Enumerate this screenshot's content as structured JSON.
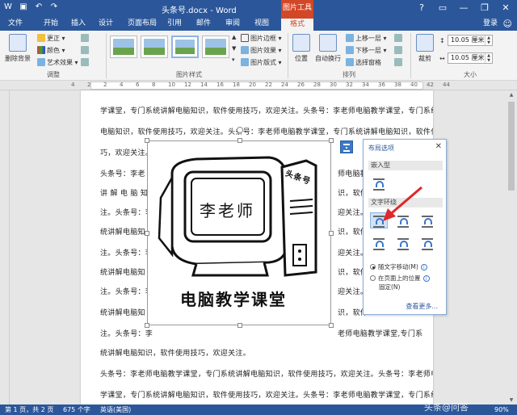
{
  "window": {
    "title": "头条号.docx - Word",
    "context_tool": "图片工具",
    "buttons": [
      "?",
      "▭",
      "—",
      "❐",
      "✕"
    ]
  },
  "quick_access": [
    "word-icon",
    "save-icon",
    "undo-icon",
    "redo-icon"
  ],
  "tabs": {
    "file": "文件",
    "items": [
      "开始",
      "插入",
      "设计",
      "页面布局",
      "引用",
      "邮件",
      "审阅",
      "视图",
      "格式"
    ],
    "active": "格式",
    "signin": "登录"
  },
  "ribbon": {
    "remove_bg": "删除背景",
    "corrections": "更正",
    "color": "颜色",
    "artistic": "艺术效果",
    "adjust_label": "调整",
    "picture_styles_label": "图片样式",
    "border": "图片边框",
    "effects": "图片效果",
    "layout": "图片版式",
    "position": "位置",
    "wrap_text": "自动换行",
    "bring_forward": "上移一层",
    "send_backward": "下移一层",
    "selection_pane": "选择窗格",
    "arrange_label": "排列",
    "crop": "裁剪",
    "height": "10.05 厘米",
    "width": "10.05 厘米",
    "size_label": "大小"
  },
  "ruler": [
    "4",
    "2",
    "2",
    "4",
    "6",
    "8",
    "10",
    "12",
    "14",
    "16",
    "18",
    "20",
    "22",
    "24",
    "26",
    "28",
    "30",
    "32",
    "34",
    "36",
    "38",
    "40",
    "42",
    "44"
  ],
  "document": {
    "lines": [
      "学课堂，专门系统讲解电脑知识，软件使用技巧，欢迎关注。头条号：李老师电脑教学课堂，专门系统讲解",
      "电脑知识，软件使用技巧，欢迎关注。头条号：李老师电脑教学课堂，专门系统讲解电脑知识，软件使用技",
      "巧，欢迎关注。",
      "头条号：李老",
      "讲 解 电 脑 知",
      "注。头条号：李",
      "统讲解电脑知",
      "注。头条号：李",
      "统讲解电脑知",
      "注。头条号：李",
      "统讲解电脑知",
      "注。头条号：李",
      "统讲解电脑知识，软件使用技巧，欢迎关注。",
      "头条号：李老师电脑教学课堂，专门系统讲解电脑知识，软件使用技巧，欢迎关注。头条号：李老师电脑教",
      "学课堂，专门系统讲解电脑知识，软件使用技巧，欢迎关注。头条号：李老师电脑教学课堂，专门系统讲解"
    ],
    "right_lines": [
      "师电脑教",
      "识，软件",
      "迎关注。",
      "识，软件",
      "迎关注。",
      "识，软件",
      "迎关注。",
      "识，软件",
      "老师电脑教学课堂,专门系"
    ],
    "image_caption": "电脑教学课堂",
    "image_handwriting": "李老师",
    "image_tag": "头条号"
  },
  "layout_options": {
    "title": "布局选项",
    "inline_section": "嵌入型",
    "wrap_section": "文字环绕",
    "radio_move": "随文字移动(M)",
    "radio_fixed_1": "在页面上的位置",
    "radio_fixed_2": "固定(N)",
    "see_more": "查看更多..."
  },
  "status": {
    "page": "第 1 页，共 2 页",
    "words": "675 个字",
    "language": "英语(美国)",
    "zoom": "90%"
  },
  "watermark": "头条@问答",
  "colors": {
    "accent": "#2b579a",
    "context": "#d24726",
    "arrow": "#e0272a"
  }
}
